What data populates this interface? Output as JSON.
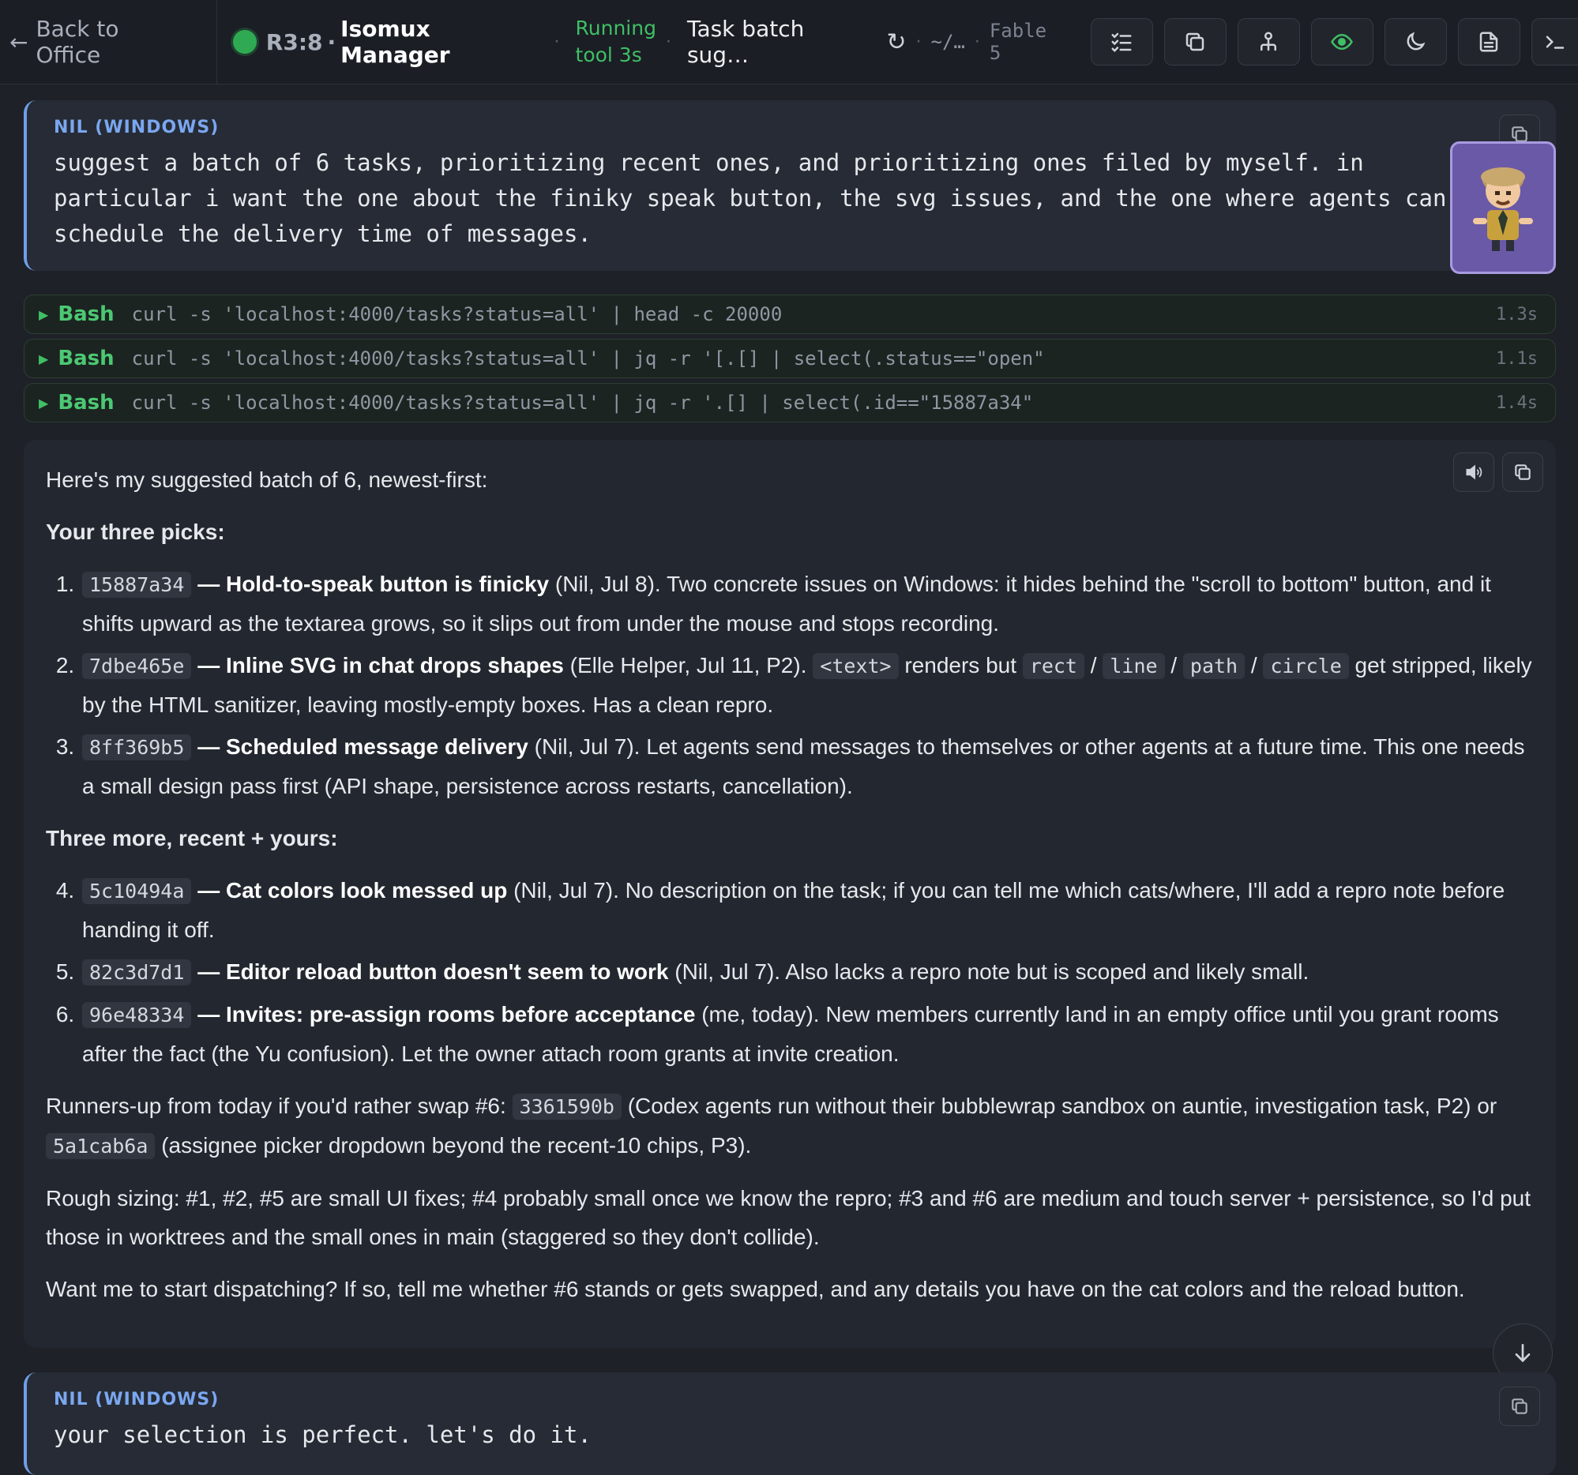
{
  "topbar": {
    "back_label": "Back to Office",
    "room": "R3:8",
    "dot_sep": "·",
    "agent_name": "Isomux Manager",
    "running_line1": "Running",
    "running_line2": "tool 3s",
    "task_title": "Task batch sug…",
    "path": "~/…",
    "model": "Fable 5",
    "buttons": [
      "tasks-icon",
      "copy-icon",
      "people-icon",
      "eye-icon",
      "moon-icon",
      "document-icon",
      "terminal-icon"
    ],
    "colors": {
      "status_green": "#2faa52",
      "running_green": "#3fbf66",
      "eye_green": "#3fbf66"
    }
  },
  "user_message_1": {
    "label": "NIL (WINDOWS)",
    "text": "suggest a batch of 6 tasks, prioritizing recent ones, and prioritizing ones filed by myself. in particular i want the one about the finiky speak button, the svg issues, and the one where agents can schedule the delivery time of messages."
  },
  "bash_calls": [
    {
      "tool": "Bash",
      "command": "curl -s 'localhost:4000/tasks?status=all' | head -c 20000",
      "duration": "1.3s"
    },
    {
      "tool": "Bash",
      "command": "curl -s 'localhost:4000/tasks?status=all' | jq -r '[.[] | select(.status==\"open\"",
      "duration": "1.1s"
    },
    {
      "tool": "Bash",
      "command": "curl -s 'localhost:4000/tasks?status=all' | jq -r '.[] | select(.id==\"15887a34\"",
      "duration": "1.4s"
    }
  ],
  "assistant": {
    "intro": "Here's my suggested batch of 6, newest-first:",
    "picks_heading": "Your three picks:",
    "picks": [
      {
        "id": "15887a34",
        "dash": " — ",
        "title": "Hold-to-speak button is finicky",
        "meta": " (Nil, Jul 8).",
        "body": " Two concrete issues on Windows: it hides behind the \"scroll to bottom\" button, and it shifts upward as the textarea grows, so it slips out from under the mouse and stops recording."
      },
      {
        "id": "7dbe465e",
        "dash": " — ",
        "title": "Inline SVG in chat drops shapes",
        "meta": " (Elle Helper, Jul 11, P2). ",
        "code1": "<text>",
        "mid": " renders but ",
        "code2": "rect",
        "slash": " / ",
        "code3": "line",
        "code4": "path",
        "code5": "circle",
        "body": " get stripped, likely by the HTML sanitizer, leaving mostly-empty boxes. Has a clean repro."
      },
      {
        "id": "8ff369b5",
        "dash": " — ",
        "title": "Scheduled message delivery",
        "meta": " (Nil, Jul 7).",
        "body": " Let agents send messages to themselves or other agents at a future time. This one needs a small design pass first (API shape, persistence across restarts, cancellation)."
      }
    ],
    "more_heading": "Three more, recent + yours:",
    "more": [
      {
        "id": "5c10494a",
        "dash": " — ",
        "title": "Cat colors look messed up",
        "meta": " (Nil, Jul 7).",
        "body": " No description on the task; if you can tell me which cats/where, I'll add a repro note before handing it off."
      },
      {
        "id": "82c3d7d1",
        "dash": " — ",
        "title": "Editor reload button doesn't seem to work",
        "meta": " (Nil, Jul 7).",
        "body": " Also lacks a repro note but is scoped and likely small."
      },
      {
        "id": "96e48334",
        "dash": " — ",
        "title": "Invites: pre-assign rooms before acceptance",
        "meta": " (me, today).",
        "body": " New members currently land in an empty office until you grant rooms after the fact (the Yu confusion). Let the owner attach room grants at invite creation."
      }
    ],
    "runners_prefix": "Runners-up from today if you'd rather swap #6: ",
    "runner1_id": "3361590b",
    "runner1_text": " (Codex agents run without their bubblewrap sandbox on auntie, investigation task, P2) or ",
    "runner2_id": "5a1cab6a",
    "runner2_text": " (assignee picker dropdown beyond the recent-10 chips, P3).",
    "sizing": "Rough sizing: #1, #2, #5 are small UI fixes; #4 probably small once we know the repro; #3 and #6 are medium and touch server + persistence, so I'd put those in worktrees and the small ones in main (staggered so they don't collide).",
    "closing": "Want me to start dispatching? If so, tell me whether #6 stands or gets swapped, and any details you have on the cat colors and the reload button."
  },
  "user_message_2": {
    "label": "NIL (WINDOWS)",
    "text": "your selection is perfect. let's do it."
  },
  "colors": {
    "background": "#1e2127",
    "user_bubble": "#262b35",
    "user_accent": "#6f9fe8",
    "bash_green": "#4cc873",
    "avatar_purple": "#6a59a6"
  }
}
